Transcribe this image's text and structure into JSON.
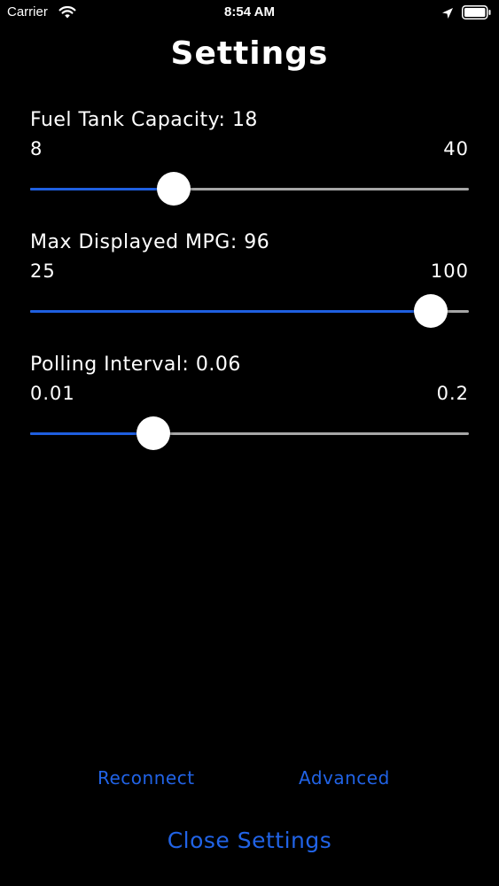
{
  "status_bar": {
    "carrier": "Carrier",
    "time": "8:54 AM"
  },
  "title": "Settings",
  "settings": [
    {
      "label": "Fuel Tank Capacity: 18",
      "min_label": "8",
      "max_label": "40",
      "min": 8,
      "max": 40,
      "value": 18
    },
    {
      "label": "Max Displayed MPG: 96",
      "min_label": "25",
      "max_label": "100",
      "min": 25,
      "max": 100,
      "value": 96
    },
    {
      "label": "Polling Interval: 0.06",
      "min_label": "0.01",
      "max_label": "0.2",
      "min": 0.01,
      "max": 0.2,
      "value": 0.06
    }
  ],
  "buttons": {
    "reconnect": "Reconnect",
    "advanced": "Advanced",
    "close_settings": "Close Settings"
  },
  "colors": {
    "accent": "#2163e6",
    "track_fill": "#1f5fe0",
    "track_bg": "#a6a6a6",
    "background": "#000000",
    "text": "#ffffff"
  }
}
